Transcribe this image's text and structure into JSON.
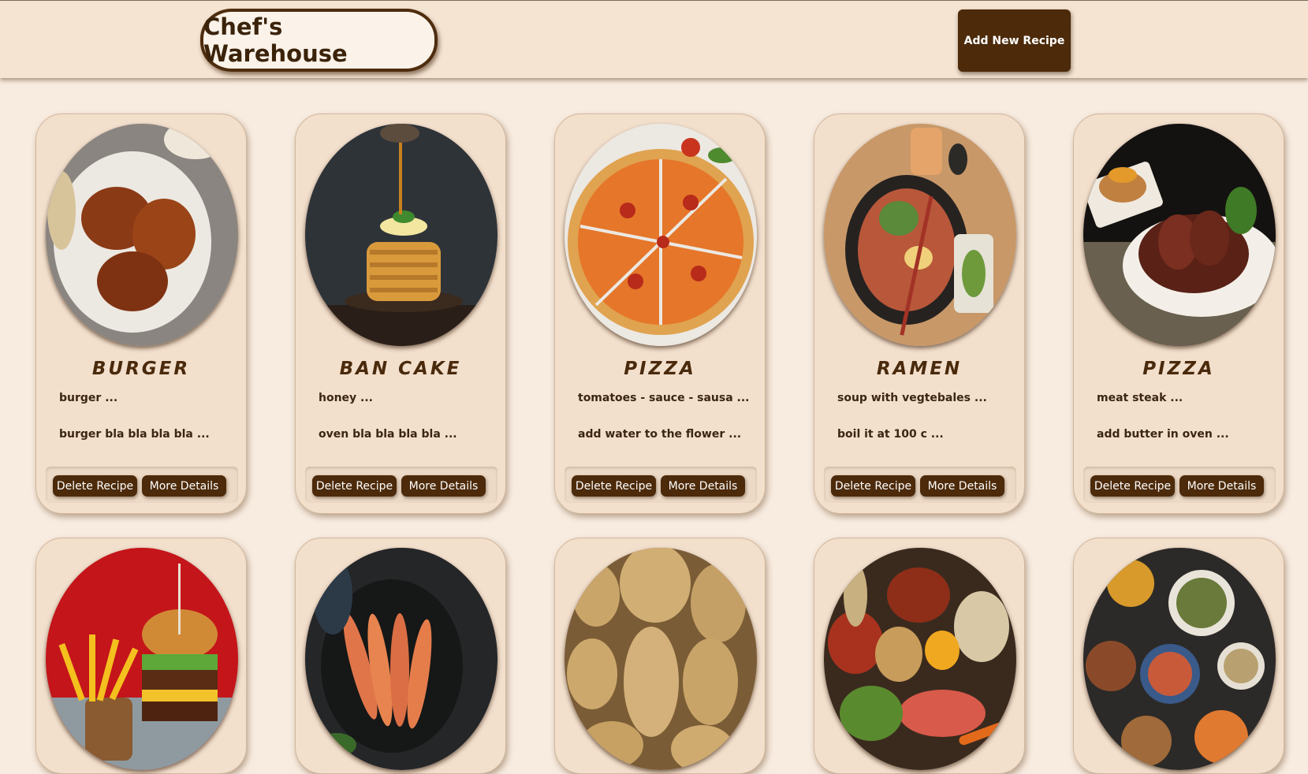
{
  "header": {
    "logo_text": "Chef's Warehouse",
    "add_button_label": "Add New Recipe"
  },
  "buttons": {
    "delete_label": "Delete Recipe",
    "details_label": "More Details"
  },
  "recipes": [
    {
      "title": "BURGER",
      "ingredients": "burger ...",
      "steps": "burger bla bla bla bla ...",
      "image": "steak-plate"
    },
    {
      "title": "BAN CAKE",
      "ingredients": "honey ...",
      "steps": "oven bla bla bla bla ...",
      "image": "pancake-stack"
    },
    {
      "title": "PIZZA",
      "ingredients": "tomatoes - sauce - sausa ...",
      "steps": "add water to the flower ...",
      "image": "pizza"
    },
    {
      "title": "RAMEN",
      "ingredients": "soup with vegtebales ...",
      "steps": "boil it at 100 c ...",
      "image": "ramen-bowl"
    },
    {
      "title": "PIZZA",
      "ingredients": "meat steak ...",
      "steps": "add butter in oven ...",
      "image": "sliced-steak"
    },
    {
      "title": "",
      "ingredients": "",
      "steps": "",
      "image": "burger-fries"
    },
    {
      "title": "",
      "ingredients": "",
      "steps": "",
      "image": "shrimp"
    },
    {
      "title": "",
      "ingredients": "",
      "steps": "",
      "image": "potatoes"
    },
    {
      "title": "",
      "ingredients": "",
      "steps": "",
      "image": "grocery-assortment"
    },
    {
      "title": "",
      "ingredients": "",
      "steps": "",
      "image": "food-spread"
    }
  ],
  "colors": {
    "page_bg": "#f8ece0",
    "card_bg": "#f2dfcc",
    "accent_brown": "#4c2a0a",
    "title_brown": "#4a2a0c"
  }
}
